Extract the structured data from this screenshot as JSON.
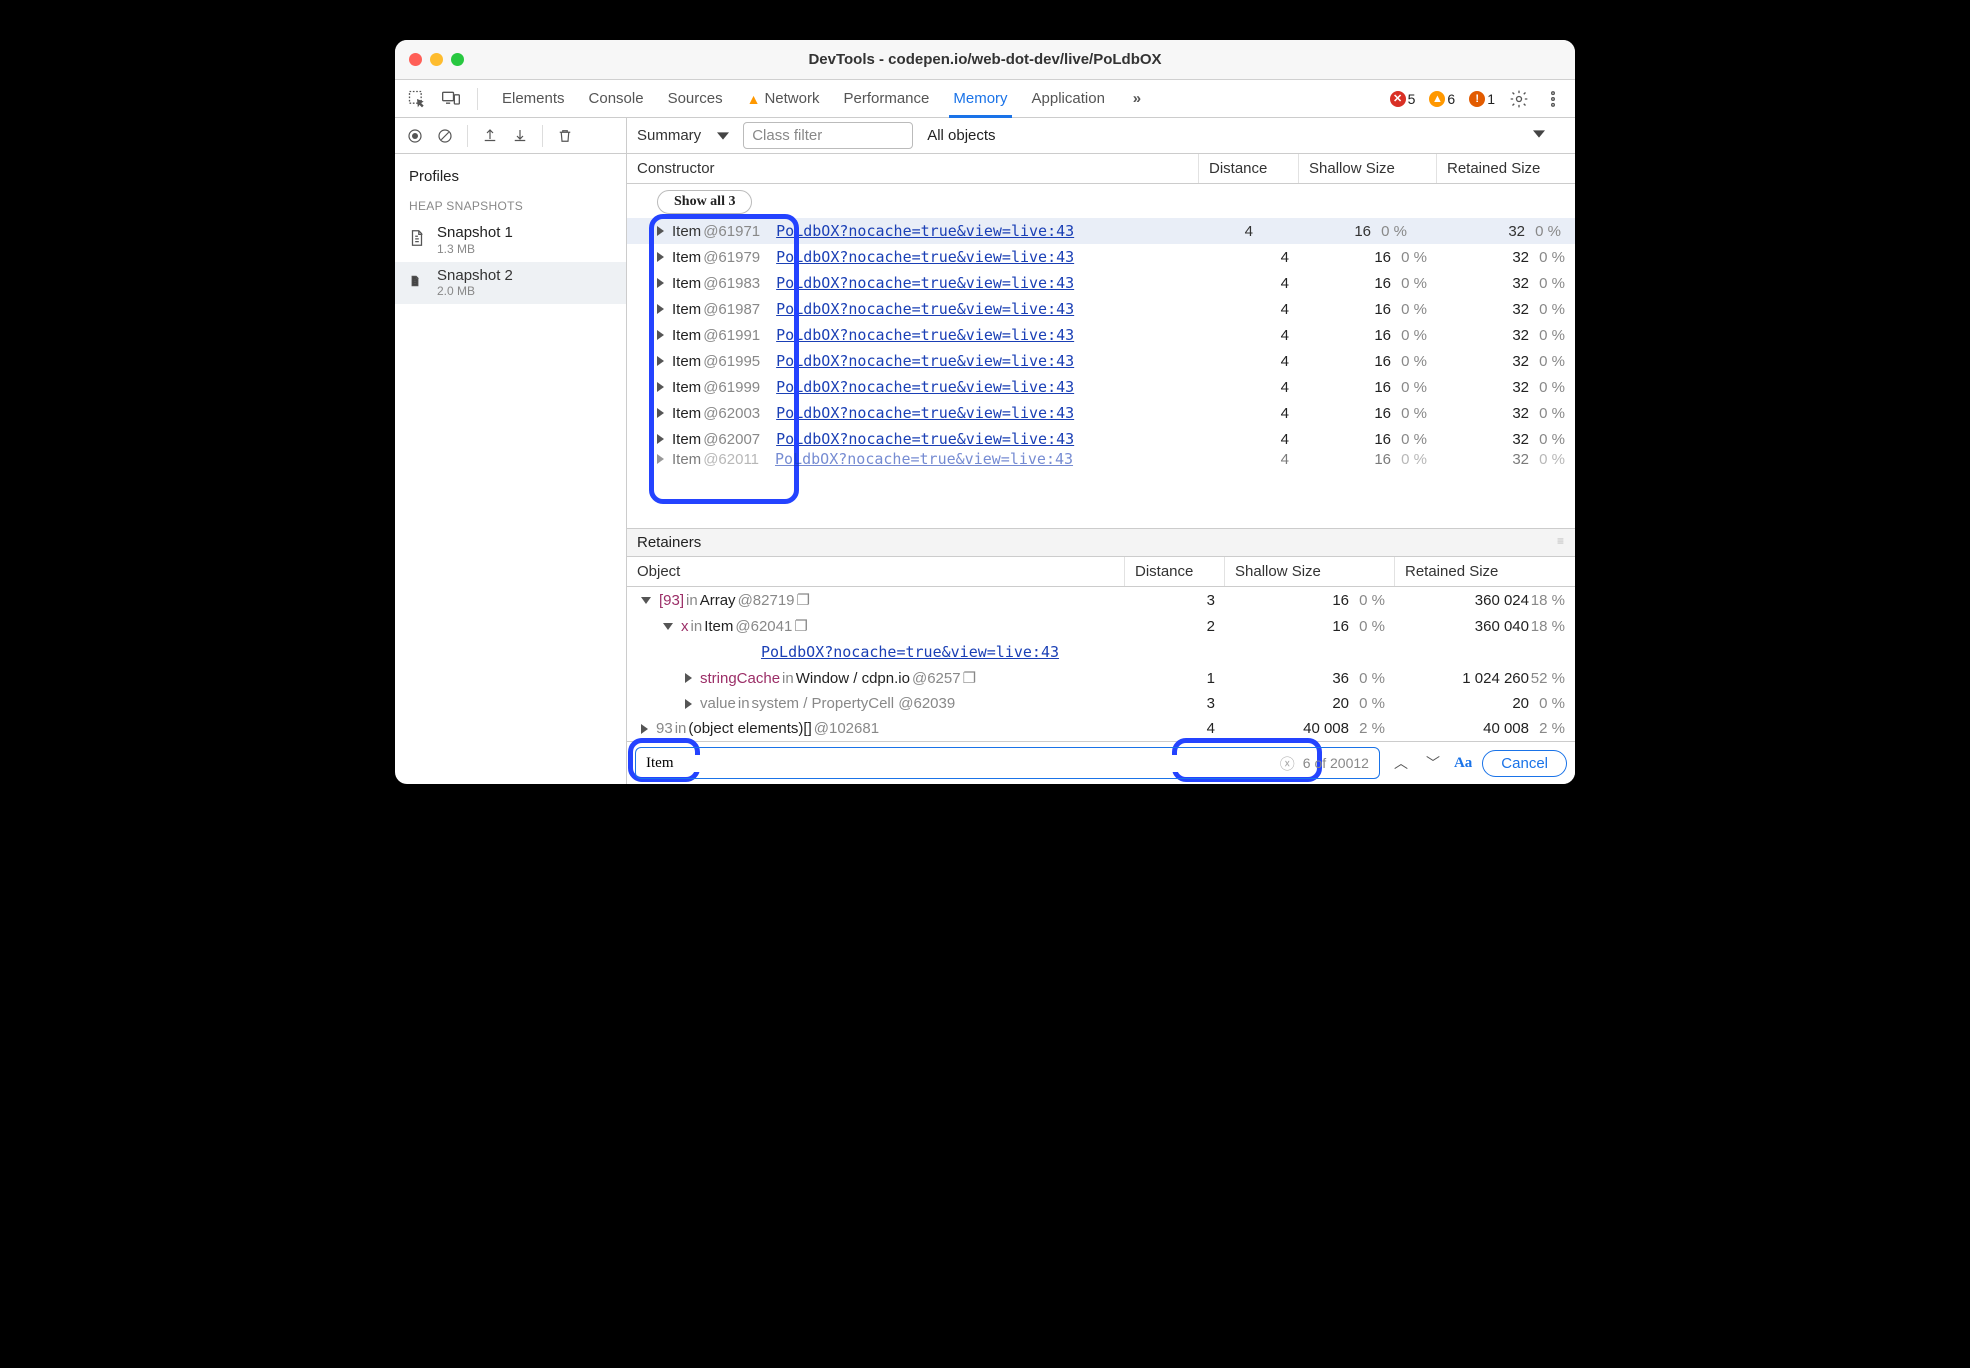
{
  "title": "DevTools - codepen.io/web-dot-dev/live/PoLdbOX",
  "tabs": [
    "Elements",
    "Console",
    "Sources",
    "Network",
    "Performance",
    "Memory",
    "Application"
  ],
  "tabs_active": 5,
  "tabs_warn_index": 3,
  "status": {
    "errors": 5,
    "warnings": 6,
    "issues": 1
  },
  "toolbar": {
    "summary": "Summary",
    "filter_placeholder": "Class filter",
    "scope": "All objects"
  },
  "sidebar": {
    "profiles": "Profiles",
    "group": "HEAP SNAPSHOTS",
    "items": [
      {
        "name": "Snapshot 1",
        "meta": "1.3 MB"
      },
      {
        "name": "Snapshot 2",
        "meta": "2.0 MB"
      }
    ],
    "selected": 1
  },
  "columns": [
    "Constructor",
    "Distance",
    "Shallow Size",
    "Retained Size"
  ],
  "show_all": "Show all 3",
  "item_link": "PoLdbOX?nocache=true&view=live:43",
  "items": [
    {
      "id": "61971",
      "dist": 4,
      "s": 16,
      "sp": "0 %",
      "r": 32,
      "rp": "0 %",
      "sel": true
    },
    {
      "id": "61979",
      "dist": 4,
      "s": 16,
      "sp": "0 %",
      "r": 32,
      "rp": "0 %"
    },
    {
      "id": "61983",
      "dist": 4,
      "s": 16,
      "sp": "0 %",
      "r": 32,
      "rp": "0 %"
    },
    {
      "id": "61987",
      "dist": 4,
      "s": 16,
      "sp": "0 %",
      "r": 32,
      "rp": "0 %"
    },
    {
      "id": "61991",
      "dist": 4,
      "s": 16,
      "sp": "0 %",
      "r": 32,
      "rp": "0 %"
    },
    {
      "id": "61995",
      "dist": 4,
      "s": 16,
      "sp": "0 %",
      "r": 32,
      "rp": "0 %"
    },
    {
      "id": "61999",
      "dist": 4,
      "s": 16,
      "sp": "0 %",
      "r": 32,
      "rp": "0 %"
    },
    {
      "id": "62003",
      "dist": 4,
      "s": 16,
      "sp": "0 %",
      "r": 32,
      "rp": "0 %"
    },
    {
      "id": "62007",
      "dist": 4,
      "s": 16,
      "sp": "0 %",
      "r": 32,
      "rp": "0 %"
    },
    {
      "id": "62011",
      "dist": 4,
      "s": 16,
      "sp": "0 %",
      "r": 32,
      "rp": "0 %",
      "cut": true
    }
  ],
  "retainers_title": "Retainers",
  "ret_columns": [
    "Object",
    "Distance",
    "Shallow Size",
    "Retained Size"
  ],
  "retainers": [
    {
      "html": "<span class='rtridown'></span><span class='idx'>[93]</span> <span class='gr'>in</span> Array <span class='gr'>@82719</span> <span class='gr'>❐</span>",
      "d": 3,
      "s": 16,
      "sp": "0 %",
      "r": "360 024",
      "rp": "18 %",
      "pad": 0
    },
    {
      "html": "<span class='rtridown'></span><span class='kw'>x</span> <span class='gr'>in</span> Item <span class='gr'>@62041</span> <span class='gr'>❐</span>",
      "d": 2,
      "s": 16,
      "sp": "0 %",
      "r": "360 040",
      "rp": "18 %",
      "pad": 22
    },
    {
      "html": "<a class='link' style='margin-left:0'>PoLdbOX?nocache=true&view=live:43</a>",
      "nocols": true,
      "pad": 120
    },
    {
      "html": "<span class='rtri'></span><span class='kw'>stringCache</span> <span class='gr'>in</span> Window / cdpn.io <span class='gr'>@6257</span> <span class='gr'>❐</span>",
      "d": 1,
      "s": 36,
      "sp": "0 %",
      "r": "1 024 260",
      "rp": "52 %",
      "pad": 44
    },
    {
      "html": "<span class='rtri'></span><span class='gr'>value</span> <span class='gr'>in</span> <span class='gr'>system / PropertyCell @62039</span>",
      "d": 3,
      "s": 20,
      "sp": "0 %",
      "r": "20",
      "rp": "0 %",
      "pad": 44
    },
    {
      "html": "<span class='rtri'></span><span class='gr'>93</span> <span class='gr'>in</span> (object elements)[] <span class='gr'>@102681</span>",
      "d": 4,
      "s": "40 008",
      "sp": "2 %",
      "r": "40 008",
      "rp": "2 %",
      "pad": 0
    }
  ],
  "search": {
    "value": "Item",
    "count": "6 of 20012",
    "aa": "Aa",
    "cancel": "Cancel"
  }
}
